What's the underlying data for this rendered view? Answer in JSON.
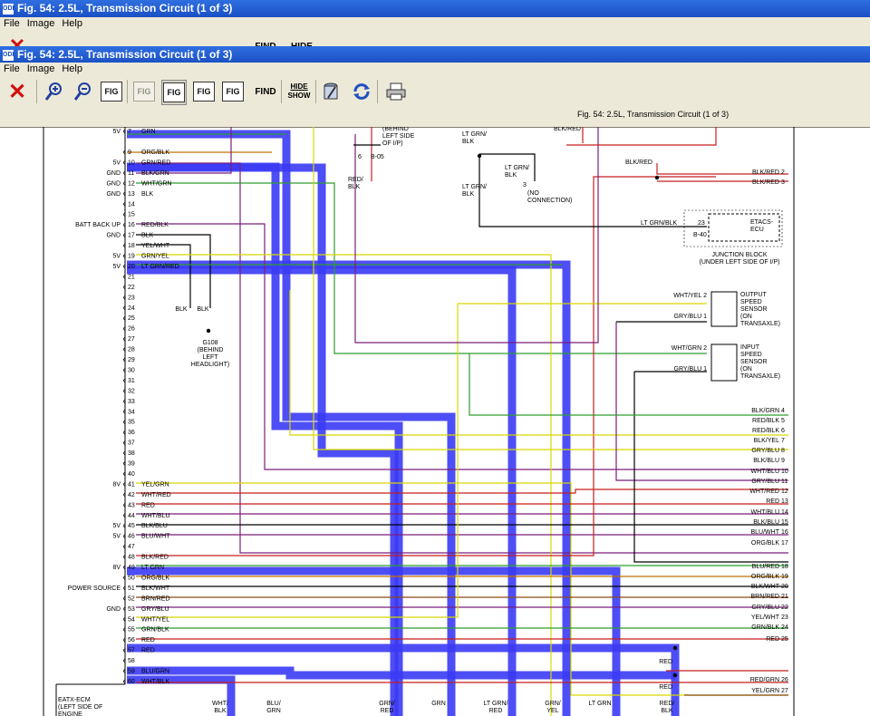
{
  "back_window": {
    "title": "Fig. 54: 2.5L, Transmission Circuit (1 of 3)",
    "menu": [
      "File",
      "Image",
      "Help"
    ]
  },
  "window": {
    "title": "Fig. 54: 2.5L, Transmission Circuit (1 of 3)",
    "menu": [
      "File",
      "Image",
      "Help"
    ],
    "toolbar": {
      "find": "FIND",
      "hide": "HIDE",
      "show": "SHOW",
      "fig": "FIG"
    },
    "figure_caption": "Fig. 54: 2.5L, Transmission Circuit (1 of 3)",
    "app_icon": "ODI"
  },
  "diagram": {
    "connector_rows": [
      {
        "pin": "7",
        "wire": "GRN",
        "volt": "5V"
      },
      {
        "pin": "9",
        "wire": "ORG/BLK",
        "volt": ""
      },
      {
        "pin": "10",
        "wire": "GRN/RED",
        "volt": "5V"
      },
      {
        "pin": "11",
        "wire": "BLK/GRN",
        "volt": "GND"
      },
      {
        "pin": "12",
        "wire": "WHT/GRN",
        "volt": "GND"
      },
      {
        "pin": "13",
        "wire": "BLK",
        "volt": "GND"
      },
      {
        "pin": "14",
        "wire": "",
        "volt": ""
      },
      {
        "pin": "15",
        "wire": "",
        "volt": ""
      },
      {
        "pin": "16",
        "wire": "RED/BLK",
        "volt": "BATT BACK UP"
      },
      {
        "pin": "17",
        "wire": "BLK",
        "volt": "GND"
      },
      {
        "pin": "18",
        "wire": "YEL/WHT",
        "volt": ""
      },
      {
        "pin": "19",
        "wire": "GRN/YEL",
        "volt": "5V"
      },
      {
        "pin": "20",
        "wire": "LT GRN/RED",
        "volt": "5V"
      },
      {
        "pin": "21",
        "wire": "",
        "volt": ""
      },
      {
        "pin": "22",
        "wire": "",
        "volt": ""
      },
      {
        "pin": "23",
        "wire": "",
        "volt": ""
      },
      {
        "pin": "24",
        "wire": "",
        "volt": ""
      },
      {
        "pin": "25",
        "wire": "",
        "volt": ""
      },
      {
        "pin": "26",
        "wire": "",
        "volt": ""
      },
      {
        "pin": "27",
        "wire": "",
        "volt": ""
      },
      {
        "pin": "28",
        "wire": "",
        "volt": ""
      },
      {
        "pin": "29",
        "wire": "",
        "volt": ""
      },
      {
        "pin": "30",
        "wire": "",
        "volt": ""
      },
      {
        "pin": "31",
        "wire": "",
        "volt": ""
      },
      {
        "pin": "32",
        "wire": "",
        "volt": ""
      },
      {
        "pin": "33",
        "wire": "",
        "volt": ""
      },
      {
        "pin": "34",
        "wire": "",
        "volt": ""
      },
      {
        "pin": "35",
        "wire": "",
        "volt": ""
      },
      {
        "pin": "36",
        "wire": "",
        "volt": ""
      },
      {
        "pin": "37",
        "wire": "",
        "volt": ""
      },
      {
        "pin": "38",
        "wire": "",
        "volt": ""
      },
      {
        "pin": "39",
        "wire": "",
        "volt": ""
      },
      {
        "pin": "40",
        "wire": "",
        "volt": ""
      },
      {
        "pin": "41",
        "wire": "YEL/GRN",
        "volt": "8V"
      },
      {
        "pin": "42",
        "wire": "WHT/RED",
        "volt": ""
      },
      {
        "pin": "43",
        "wire": "RED",
        "volt": ""
      },
      {
        "pin": "44",
        "wire": "WHT/BLU",
        "volt": ""
      },
      {
        "pin": "45",
        "wire": "BLK/BLU",
        "volt": "5V"
      },
      {
        "pin": "46",
        "wire": "BLU/WHT",
        "volt": "5V"
      },
      {
        "pin": "47",
        "wire": "",
        "volt": ""
      },
      {
        "pin": "48",
        "wire": "BLK/RED",
        "volt": ""
      },
      {
        "pin": "49",
        "wire": "LT GRN",
        "volt": "8V"
      },
      {
        "pin": "50",
        "wire": "ORG/BLK",
        "volt": ""
      },
      {
        "pin": "51",
        "wire": "BLK/WHT",
        "volt": "POWER SOURCE"
      },
      {
        "pin": "52",
        "wire": "BRN/RED",
        "volt": ""
      },
      {
        "pin": "53",
        "wire": "GRY/BLU",
        "volt": "GND"
      },
      {
        "pin": "54",
        "wire": "WHT/YEL",
        "volt": ""
      },
      {
        "pin": "55",
        "wire": "GRN/BLK",
        "volt": ""
      },
      {
        "pin": "56",
        "wire": "RED",
        "volt": ""
      },
      {
        "pin": "57",
        "wire": "RED",
        "volt": ""
      },
      {
        "pin": "58",
        "wire": "",
        "volt": ""
      },
      {
        "pin": "59",
        "wire": "BLU/GRN",
        "volt": ""
      },
      {
        "pin": "60",
        "wire": "WHT/BLK",
        "volt": ""
      }
    ],
    "right_labels": [
      {
        "wire": "BLK/RED",
        "pin": "2"
      },
      {
        "wire": "BLK/RED",
        "pin": "3"
      },
      {
        "wire": "BLK/GRN",
        "pin": "4"
      },
      {
        "wire": "RED/BLK",
        "pin": "5"
      },
      {
        "wire": "RED/BLK",
        "pin": "6"
      },
      {
        "wire": "BLK/YEL",
        "pin": "7"
      },
      {
        "wire": "GRY/BLU",
        "pin": "8"
      },
      {
        "wire": "BLK/BLU",
        "pin": "9"
      },
      {
        "wire": "WHT/BLU",
        "pin": "10"
      },
      {
        "wire": "GRY/BLU",
        "pin": "11"
      },
      {
        "wire": "WHT/RED",
        "pin": "12"
      },
      {
        "wire": "RED",
        "pin": "13"
      },
      {
        "wire": "WHT/BLU",
        "pin": "14"
      },
      {
        "wire": "BLK/BLU",
        "pin": "15"
      },
      {
        "wire": "BLU/WHT",
        "pin": "16"
      },
      {
        "wire": "ORG/BLK",
        "pin": "17"
      },
      {
        "wire": "BLU/RED",
        "pin": "18"
      },
      {
        "wire": "ORG/BLK",
        "pin": "19"
      },
      {
        "wire": "BLK/WHT",
        "pin": "20"
      },
      {
        "wire": "BRN/RED",
        "pin": "21"
      },
      {
        "wire": "GRY/BLU",
        "pin": "22"
      },
      {
        "wire": "YEL/WHT",
        "pin": "23"
      },
      {
        "wire": "GRN/BLK",
        "pin": "24"
      },
      {
        "wire": "RED",
        "pin": "25"
      },
      {
        "wire": "RED/GRN",
        "pin": "26"
      },
      {
        "wire": "YEL/GRN",
        "pin": "27"
      }
    ],
    "texts": {
      "behind_ip": [
        "(BEHIND",
        "LEFT SIDE",
        "OF I/P)"
      ],
      "b05": "B-05",
      "b05_pin": "6",
      "red_blk": [
        "RED/",
        "BLK"
      ],
      "lt_grn_blk_top": [
        "LT GRN/",
        "BLK"
      ],
      "lt_grn_blk_mid": [
        "LT GRN/",
        "BLK"
      ],
      "lt_grn_blk_left": [
        "LT GRN/",
        "BLK"
      ],
      "no_conn_pin": "3",
      "no_conn": [
        "(NO",
        "CONNECTION)"
      ],
      "blk_red_top": "BLK/RED",
      "blk_red_mid": "BLK/RED",
      "lt_grn_blk_etacs": "LT GRN/BLK",
      "etacs_pin": "23",
      "b40": "B-40",
      "etacs": [
        "ETACS-",
        "ECU"
      ],
      "junction": [
        "JUNCTION BLOCK",
        "(UNDER LEFT SIDE OF I/P)"
      ],
      "wht_yel_2": "WHT/YEL 2",
      "gry_blu_1a": "GRY/BLU 1",
      "output_sensor": [
        "OUTPUT",
        "SPEED",
        "SENSOR",
        "(ON",
        "TRANSAXLE)"
      ],
      "wht_grn_2": "WHT/GRN 2",
      "gry_blu_1b": "GRY/BLU 1",
      "input_sensor": [
        "INPUT",
        "SPEED",
        "SENSOR",
        "(ON",
        "TRANSAXLE)"
      ],
      "blk_blk": [
        "BLK",
        "BLK"
      ],
      "g108": [
        "G108",
        "(BEHIND",
        "LEFT",
        "HEADLIGHT)"
      ],
      "red_mid": "RED",
      "red_low": "RED",
      "ecm": [
        "EATX-ECM",
        "(LEFT SIDE OF",
        "ENGINE"
      ],
      "bottom_labels": [
        "WHT/",
        "BLU/",
        "GRN/",
        "GRN",
        "LT GRN/",
        "GRN/",
        "LT GRN",
        "RED/"
      ],
      "bottom_labels2": [
        "BLK",
        "GRN",
        "RED",
        "",
        "RED",
        "YEL",
        "",
        "BLK"
      ]
    },
    "colors": {
      "highlight": "#3b3bf5",
      "grn": "#2e9e2e",
      "red": "#c81e1e",
      "blk": "#000000",
      "yel": "#d8d800",
      "org": "#c07000",
      "purple": "#7a1f7a",
      "brn": "#8a4a1a"
    }
  }
}
